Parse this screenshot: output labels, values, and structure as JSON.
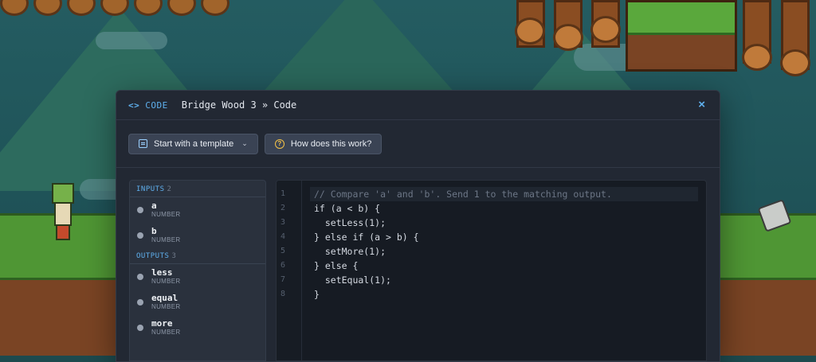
{
  "header": {
    "badge_icon": "<>",
    "badge_label": "CODE",
    "breadcrumb": "Bridge Wood 3 » Code",
    "close_icon": "×"
  },
  "toolbar": {
    "template_button_label": "Start with a template",
    "help_button_label": "How does this work?"
  },
  "inputs": {
    "heading": "INPUTS",
    "count": "2",
    "items": [
      {
        "name": "a",
        "type": "NUMBER"
      },
      {
        "name": "b",
        "type": "NUMBER"
      }
    ]
  },
  "outputs": {
    "heading": "OUTPUTS",
    "count": "3",
    "items": [
      {
        "name": "less",
        "type": "NUMBER"
      },
      {
        "name": "equal",
        "type": "NUMBER"
      },
      {
        "name": "more",
        "type": "NUMBER"
      }
    ]
  },
  "editor": {
    "line_numbers": [
      "1",
      "2",
      "3",
      "4",
      "5",
      "6",
      "7",
      "8"
    ],
    "lines": [
      "// Compare 'a' and 'b'. Send 1 to the matching output.",
      "if (a < b) {",
      "  setLess(1);",
      "} else if (a > b) {",
      "  setMore(1);",
      "} else {",
      "  setEqual(1);",
      "}"
    ]
  },
  "colors": {
    "accent": "#5fb0ee",
    "modal_bg": "#222833",
    "editor_bg": "#161b23",
    "help_icon": "#f4c247"
  }
}
